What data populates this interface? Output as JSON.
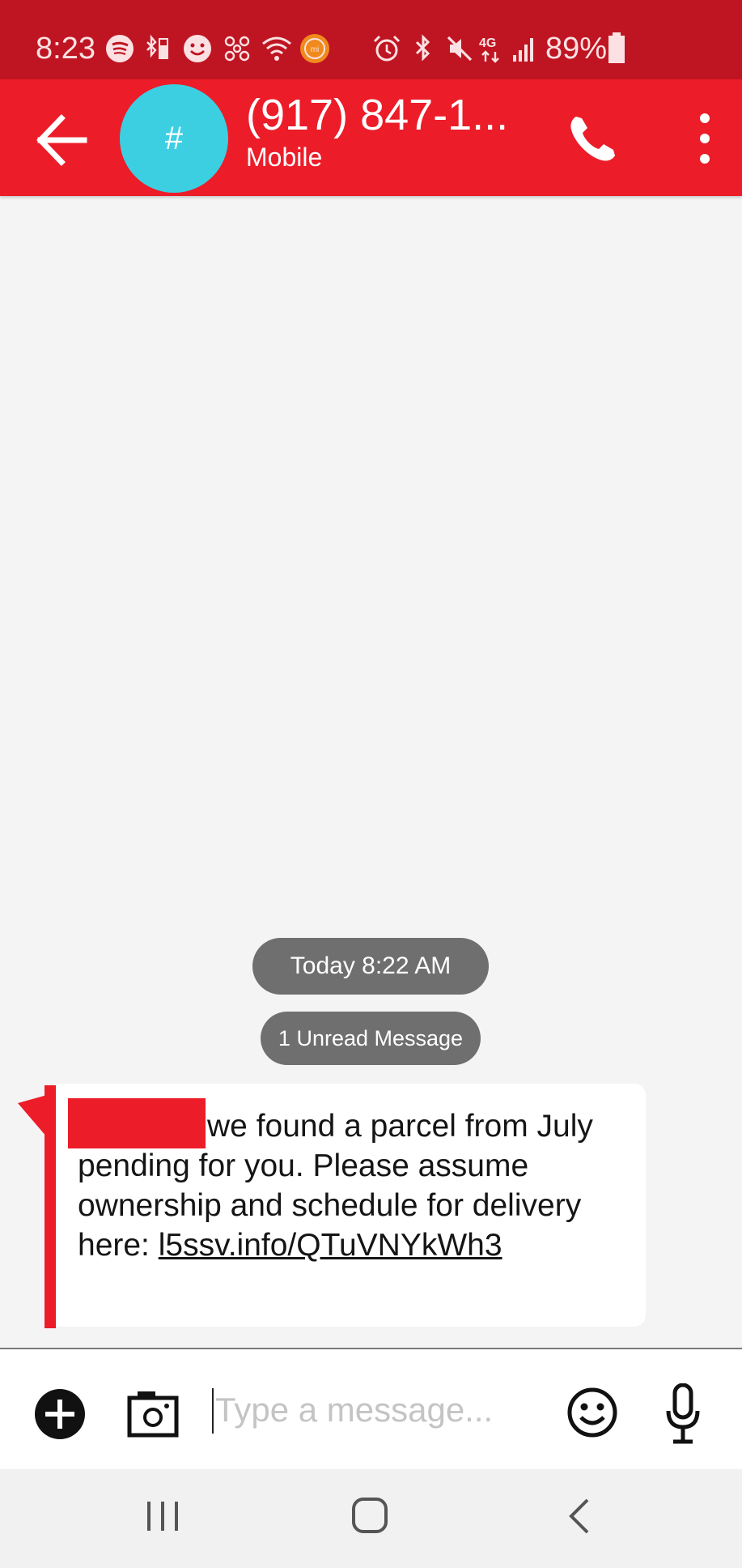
{
  "status_bar": {
    "time": "8:23",
    "battery_percent": "89%",
    "icons": [
      "spotify-icon",
      "bluetooth-battery-icon",
      "smiley-icon",
      "fan-icon",
      "wifi-icon",
      "mi-icon",
      "alarm-icon",
      "bluetooth-icon",
      "mute-icon",
      "4g-lte-icon",
      "signal-icon",
      "battery-icon"
    ],
    "mi_label": "mi"
  },
  "header": {
    "contact_name": "(917) 847-1...",
    "contact_type": "Mobile",
    "avatar_symbol": "#",
    "avatar_color": "#3ccfe2",
    "bar_color": "#ec1c29"
  },
  "conversation": {
    "date_chip": "Today 8:22 AM",
    "unread_chip": "1 Unread Message",
    "message": {
      "text": "we found a parcel from July pending for you. Please assume ownership and schedule for delivery here: ",
      "link": "l5ssv.info/​QTuVNYkWh3",
      "redaction_color": "#ec1c29"
    }
  },
  "compose": {
    "placeholder": "Type a message...",
    "value": ""
  },
  "nav": {
    "icons": [
      "recent-apps-icon",
      "home-icon",
      "back-nav-icon"
    ]
  }
}
